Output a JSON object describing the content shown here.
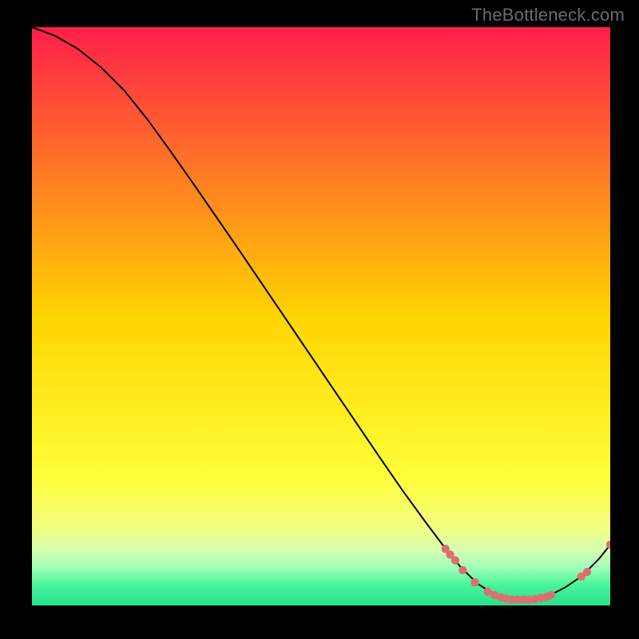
{
  "watermark": "TheBottleneck.com",
  "chart_data": {
    "type": "line",
    "title": "",
    "xlabel": "",
    "ylabel": "",
    "xlim": [
      0,
      100
    ],
    "ylim": [
      0,
      100
    ],
    "grid": false,
    "legend": false,
    "background_gradient": {
      "stops": [
        {
          "pos": 0.0,
          "color": "#ff1e4a"
        },
        {
          "pos": 0.5,
          "color": "#ffd400"
        },
        {
          "pos": 0.78,
          "color": "#ffff3a"
        },
        {
          "pos": 0.86,
          "color": "#f4ff7d"
        },
        {
          "pos": 0.905,
          "color": "#d6ffb0"
        },
        {
          "pos": 0.935,
          "color": "#9fffb8"
        },
        {
          "pos": 0.965,
          "color": "#48f59a"
        },
        {
          "pos": 1.0,
          "color": "#27e08e"
        }
      ]
    },
    "curve": {
      "color": "#000000",
      "width": 2,
      "points": [
        {
          "x": 0,
          "y": 100
        },
        {
          "x": 4,
          "y": 98.5
        },
        {
          "x": 8,
          "y": 96.2
        },
        {
          "x": 12,
          "y": 93.0
        },
        {
          "x": 16,
          "y": 89.0
        },
        {
          "x": 20,
          "y": 84.0
        },
        {
          "x": 24,
          "y": 78.5
        },
        {
          "x": 28,
          "y": 72.8
        },
        {
          "x": 32,
          "y": 67.0
        },
        {
          "x": 36,
          "y": 61.2
        },
        {
          "x": 40,
          "y": 55.3
        },
        {
          "x": 44,
          "y": 49.4
        },
        {
          "x": 48,
          "y": 43.5
        },
        {
          "x": 52,
          "y": 37.6
        },
        {
          "x": 56,
          "y": 31.7
        },
        {
          "x": 60,
          "y": 25.8
        },
        {
          "x": 64,
          "y": 20.0
        },
        {
          "x": 68,
          "y": 14.5
        },
        {
          "x": 71,
          "y": 10.5
        },
        {
          "x": 74,
          "y": 6.8
        },
        {
          "x": 77,
          "y": 3.8
        },
        {
          "x": 80,
          "y": 1.9
        },
        {
          "x": 83,
          "y": 1.0
        },
        {
          "x": 86,
          "y": 1.0
        },
        {
          "x": 89,
          "y": 1.5
        },
        {
          "x": 92,
          "y": 3.0
        },
        {
          "x": 95,
          "y": 5.0
        },
        {
          "x": 98,
          "y": 8.0
        },
        {
          "x": 100,
          "y": 10.5
        }
      ]
    },
    "markers": {
      "color": "#dc7070",
      "radius": 5.2,
      "points": [
        {
          "x": 71.5,
          "y": 9.8
        },
        {
          "x": 72.3,
          "y": 8.8
        },
        {
          "x": 73.2,
          "y": 7.8
        },
        {
          "x": 74.5,
          "y": 6.1
        },
        {
          "x": 76.6,
          "y": 4.0
        },
        {
          "x": 78.8,
          "y": 2.4
        },
        {
          "x": 80.0,
          "y": 1.8
        },
        {
          "x": 81.1,
          "y": 1.4
        },
        {
          "x": 82.0,
          "y": 1.2
        },
        {
          "x": 83.0,
          "y": 1.0
        },
        {
          "x": 84.0,
          "y": 1.0
        },
        {
          "x": 85.0,
          "y": 1.0
        },
        {
          "x": 86.0,
          "y": 1.0
        },
        {
          "x": 87.0,
          "y": 1.1
        },
        {
          "x": 88.0,
          "y": 1.3
        },
        {
          "x": 89.0,
          "y": 1.5
        },
        {
          "x": 89.8,
          "y": 1.8
        },
        {
          "x": 95.0,
          "y": 5.0
        },
        {
          "x": 96.0,
          "y": 5.8
        },
        {
          "x": 100.0,
          "y": 10.5
        }
      ]
    }
  }
}
